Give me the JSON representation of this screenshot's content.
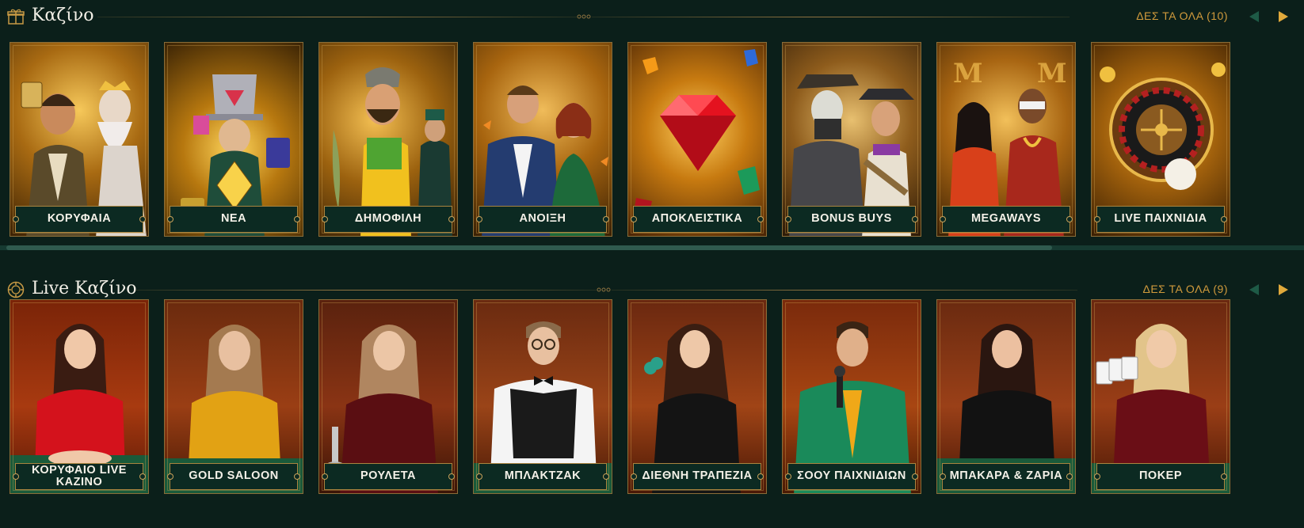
{
  "casino": {
    "title": "Καζίνο",
    "see_all": "ΔΕΣ ΤΑ ΟΛΑ (10)",
    "icon": "gift-box-icon",
    "cards": [
      {
        "label": "ΚΟΡΥΦΑΙΑ",
        "name": "card-top"
      },
      {
        "label": "ΝΕΑ",
        "name": "card-new"
      },
      {
        "label": "ΔΗΜΟΦΙΛΗ",
        "name": "card-popular"
      },
      {
        "label": "ΑΝΟΙΞΗ",
        "name": "card-spring"
      },
      {
        "label": "ΑΠΟΚΛΕΙΣΤΙΚΑ",
        "name": "card-exclusive"
      },
      {
        "label": "BONUS BUYS",
        "name": "card-bonus-buys"
      },
      {
        "label": "MEGAWAYS",
        "name": "card-megaways"
      },
      {
        "label": "LIVE ΠΑΙΧΝΙΔΙΑ",
        "name": "card-live-games"
      }
    ]
  },
  "live": {
    "title": "Live Καζίνο",
    "see_all": "ΔΕΣ ΤΑ ΟΛΑ (9)",
    "icon": "poker-chip-icon",
    "cards": [
      {
        "label": "ΚΟΡΥΦΑΙΟ LIVE ΚΑΖΙΝΟ",
        "name": "card-top-live-casino"
      },
      {
        "label": "GOLD SALOON",
        "name": "card-gold-saloon"
      },
      {
        "label": "ΡΟΥΛΕΤΑ",
        "name": "card-roulette"
      },
      {
        "label": "ΜΠΛΑΚΤΖΑΚ",
        "name": "card-blackjack"
      },
      {
        "label": "ΔΙΕΘΝΗ ΤΡΑΠΕΖΙΑ",
        "name": "card-international-tables"
      },
      {
        "label": "ΣΟΟΥ ΠΑΙΧΝΙΔΙΩΝ",
        "name": "card-game-shows"
      },
      {
        "label": "ΜΠΑΚΑΡΑ & ΖΑΡΙΑ",
        "name": "card-baccarat-dice"
      },
      {
        "label": "ΠΟΚΕΡ",
        "name": "card-poker"
      }
    ]
  },
  "colors": {
    "background": "#0b1f1a",
    "accent_gold": "#d09a3c",
    "label_bg": "#0c2a22",
    "arrow_inactive": "#1e5a46",
    "arrow_active": "#e0a93b"
  }
}
